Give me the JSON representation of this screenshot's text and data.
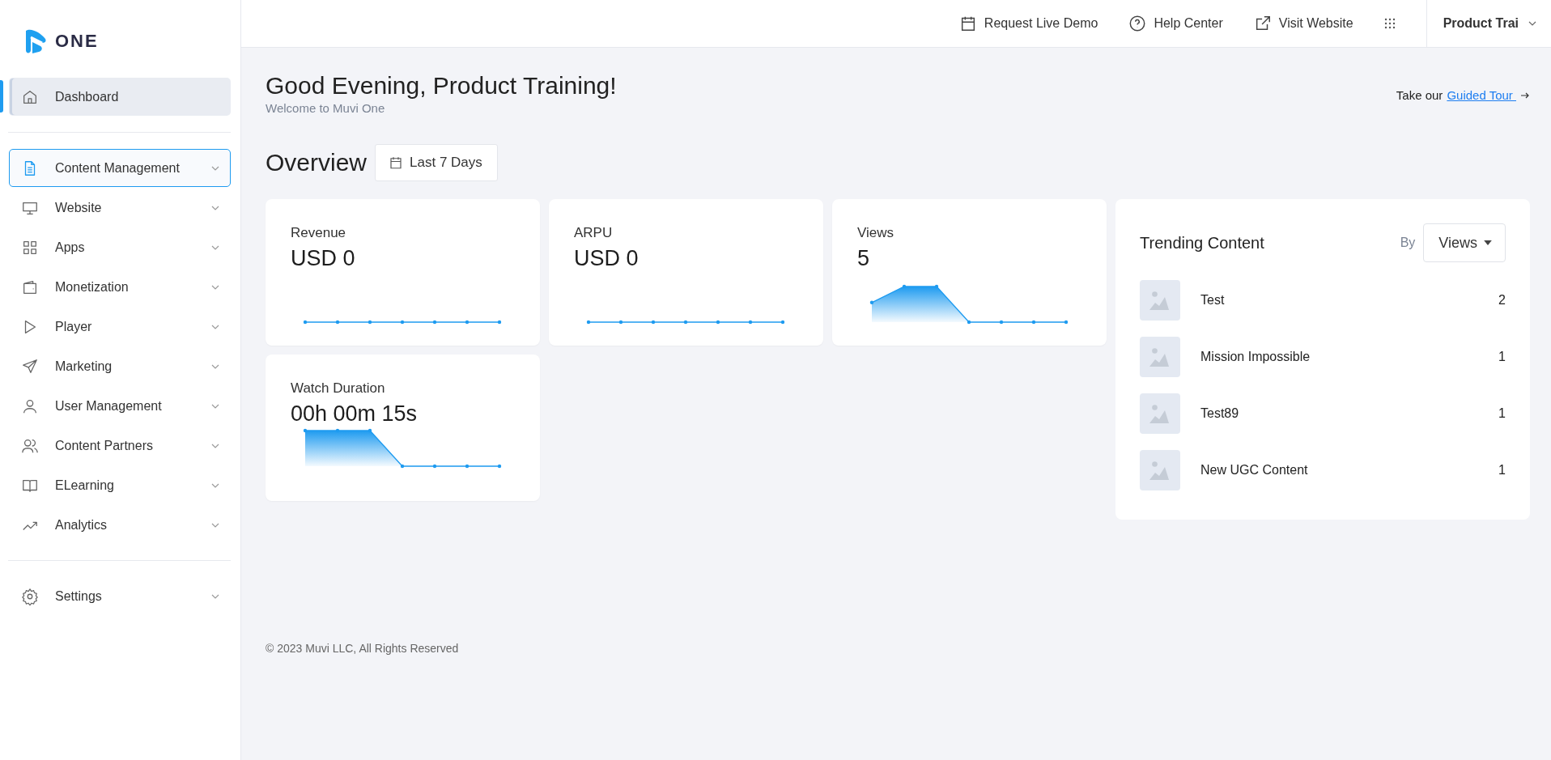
{
  "brand": {
    "name": "ONE"
  },
  "sidebar": {
    "items": [
      {
        "label": "Dashboard",
        "selected": true,
        "focused": false,
        "expandable": false
      },
      {
        "label": "Content Management",
        "selected": false,
        "focused": true,
        "expandable": true
      },
      {
        "label": "Website",
        "selected": false,
        "focused": false,
        "expandable": true
      },
      {
        "label": "Apps",
        "selected": false,
        "focused": false,
        "expandable": true
      },
      {
        "label": "Monetization",
        "selected": false,
        "focused": false,
        "expandable": true
      },
      {
        "label": "Player",
        "selected": false,
        "focused": false,
        "expandable": true
      },
      {
        "label": "Marketing",
        "selected": false,
        "focused": false,
        "expandable": true
      },
      {
        "label": "User Management",
        "selected": false,
        "focused": false,
        "expandable": true
      },
      {
        "label": "Content Partners",
        "selected": false,
        "focused": false,
        "expandable": true
      },
      {
        "label": "ELearning",
        "selected": false,
        "focused": false,
        "expandable": true
      },
      {
        "label": "Analytics",
        "selected": false,
        "focused": false,
        "expandable": true
      },
      {
        "label": "Settings",
        "selected": false,
        "focused": false,
        "expandable": true
      }
    ]
  },
  "topbar": {
    "links": [
      "Request Live Demo",
      "Help Center",
      "Visit Website"
    ],
    "user": "Product Trai"
  },
  "greeting": {
    "title": "Good Evening, Product Training!",
    "subtitle": "Welcome to Muvi One"
  },
  "tour": {
    "prefix": "Take our",
    "link": "Guided Tour "
  },
  "overview": {
    "title": "Overview",
    "range": "Last 7 Days"
  },
  "metrics": [
    {
      "label": "Revenue",
      "value": "USD 0",
      "kind": "flat"
    },
    {
      "label": "ARPU",
      "value": "USD 0",
      "kind": "flat"
    },
    {
      "label": "Views",
      "value": "5",
      "kind": "peak"
    },
    {
      "label": "Watch Duration",
      "value": "00h 00m 15s",
      "kind": "drop"
    }
  ],
  "trending": {
    "title": "Trending Content",
    "by": "By",
    "sort": "Views",
    "items": [
      {
        "title": "Test",
        "count": "2"
      },
      {
        "title": "Mission Impossible",
        "count": "1"
      },
      {
        "title": "Test89",
        "count": "1"
      },
      {
        "title": "New UGC Content",
        "count": "1"
      }
    ]
  },
  "footer": "© 2023 Muvi LLC, All Rights Reserved"
}
